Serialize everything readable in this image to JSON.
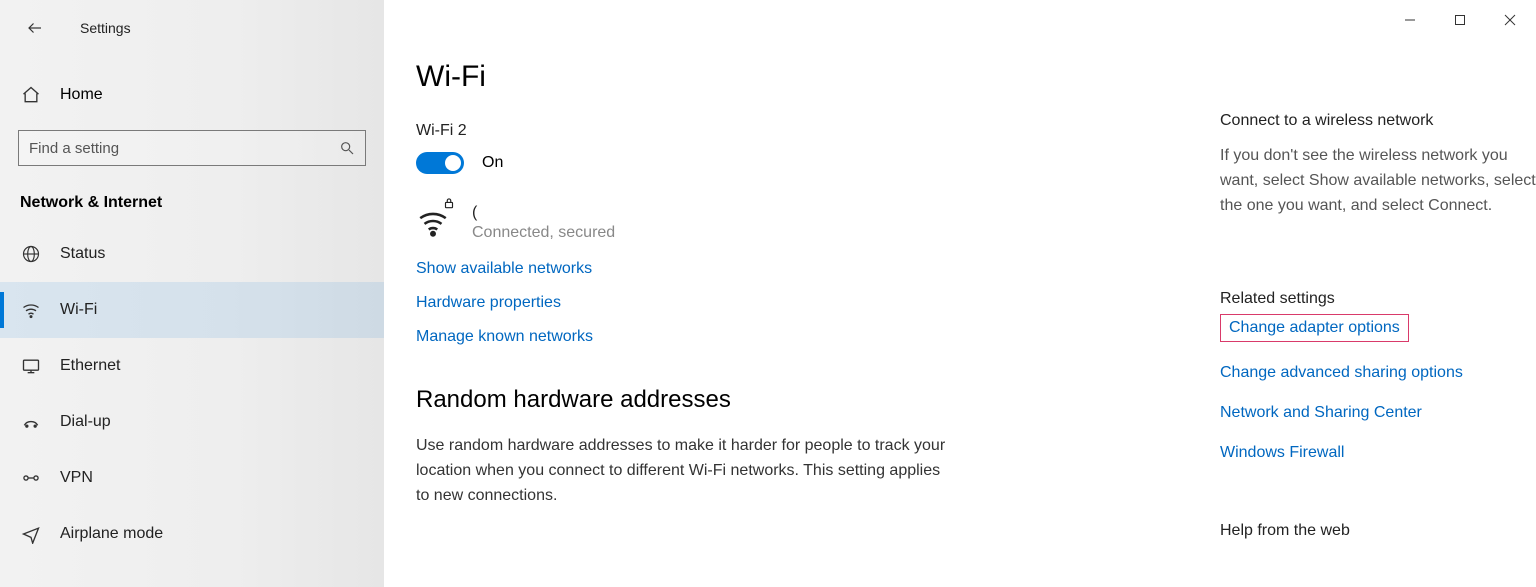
{
  "app_title": "Settings",
  "search_placeholder": "Find a setting",
  "home_label": "Home",
  "category_title": "Network & Internet",
  "nav": [
    {
      "label": "Status"
    },
    {
      "label": "Wi-Fi"
    },
    {
      "label": "Ethernet"
    },
    {
      "label": "Dial-up"
    },
    {
      "label": "VPN"
    },
    {
      "label": "Airplane mode"
    }
  ],
  "page": {
    "title": "Wi-Fi",
    "adapter_label": "Wi-Fi 2",
    "toggle_state": "On",
    "network_name": "(",
    "network_status": "Connected, secured",
    "links": {
      "show_networks": "Show available networks",
      "hw_props": "Hardware properties",
      "known_nets": "Manage known networks"
    },
    "random_h": "Random hardware addresses",
    "random_body": "Use random hardware addresses to make it harder for people to track your location when you connect to different Wi-Fi networks. This setting applies to new connections."
  },
  "right": {
    "connect_h": "Connect to a wireless network",
    "connect_p": "If you don't see the wireless network you want, select Show available networks, select the one you want, and select Connect.",
    "related_h": "Related settings",
    "links": {
      "adapter": "Change adapter options",
      "sharing": "Change advanced sharing options",
      "center": "Network and Sharing Center",
      "firewall": "Windows Firewall"
    },
    "help_h": "Help from the web"
  }
}
